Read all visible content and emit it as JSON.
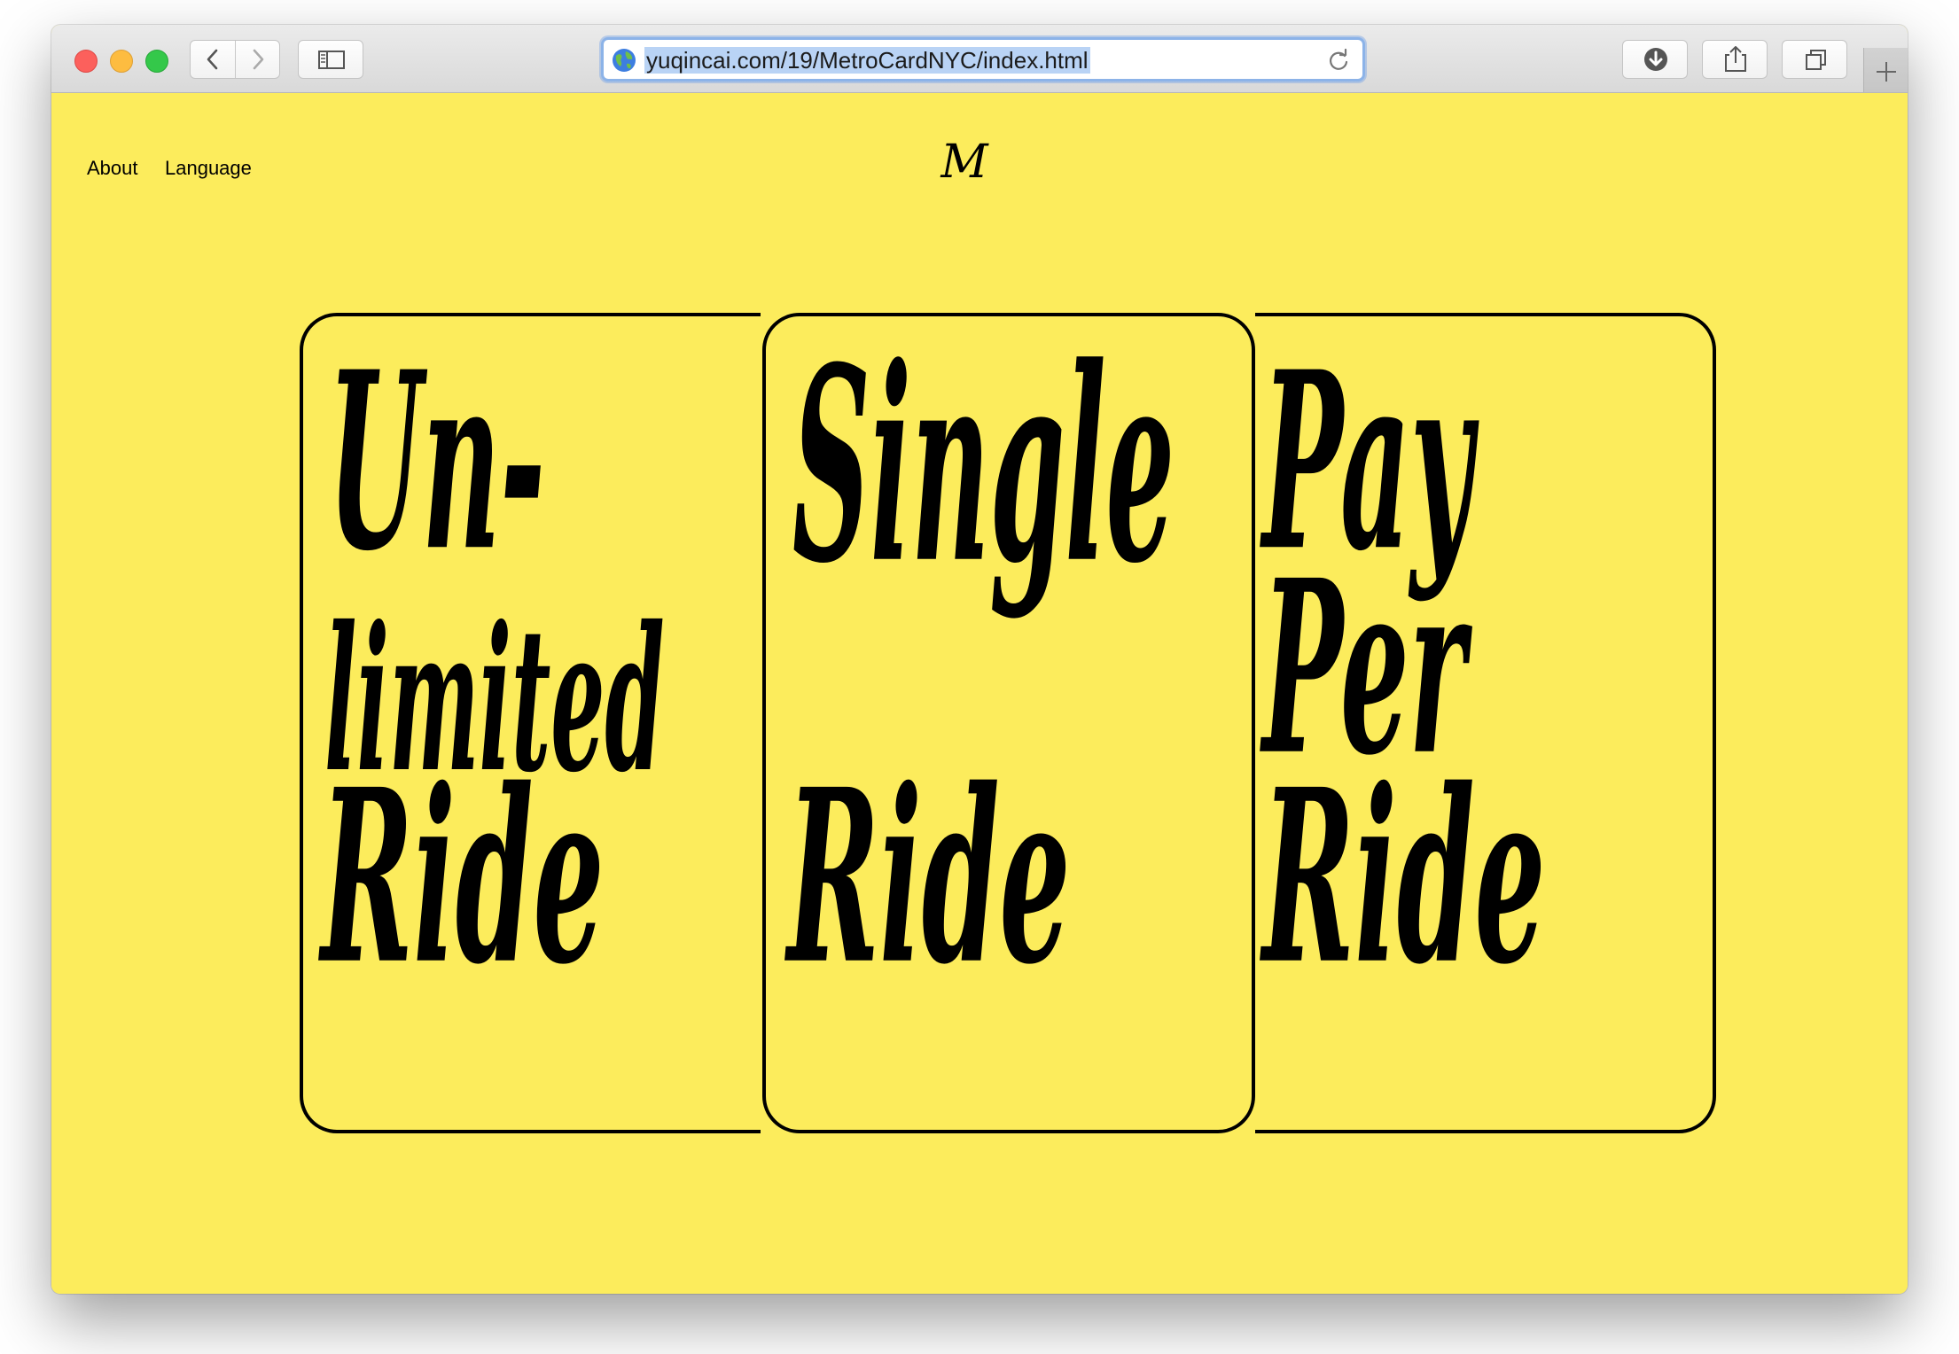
{
  "browser": {
    "url": "yuqincai.com/19/MetroCardNYC/index.html",
    "icons": {
      "back": "chevron-left-icon",
      "forward": "chevron-right-icon",
      "sidebar": "sidebar-icon",
      "downloads": "download-icon",
      "share": "share-icon",
      "tabs": "tabs-icon",
      "new_tab": "plus-icon",
      "reload": "reload-icon",
      "site": "globe-icon"
    }
  },
  "page": {
    "background": "#fcec5c",
    "nav": {
      "about": "About",
      "language": "Language"
    },
    "logo": "M",
    "cards": [
      {
        "id": "unlimited",
        "lines": [
          "Un-",
          "limited",
          "Ride"
        ]
      },
      {
        "id": "single",
        "lines": [
          "Single",
          "",
          "Ride"
        ]
      },
      {
        "id": "pay",
        "lines": [
          "Pay",
          "Per",
          "Ride"
        ]
      }
    ]
  }
}
